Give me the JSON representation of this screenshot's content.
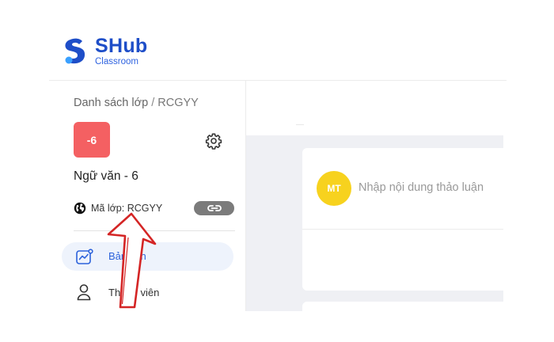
{
  "brand": {
    "name": "SHub",
    "subtitle": "Classroom",
    "color": "#1e4ec8"
  },
  "sidebar": {
    "breadcrumb": {
      "root": "Danh sách lớp",
      "separator": "/",
      "current": "RCGYY"
    },
    "class_avatar_text": "-6",
    "class_avatar_color": "#f46062",
    "class_name": "Ngữ văn - 6",
    "class_code_label": "Mã lớp: RCGYY",
    "nav": [
      {
        "label": "Bảng tin",
        "icon": "chart-icon",
        "active": true
      },
      {
        "label": "Thành viên",
        "icon": "person-icon",
        "active": false
      }
    ]
  },
  "main": {
    "composer_avatar": "MT",
    "composer_avatar_color": "#f7d21e",
    "composer_placeholder": "Nhập nội dung thảo luận"
  }
}
